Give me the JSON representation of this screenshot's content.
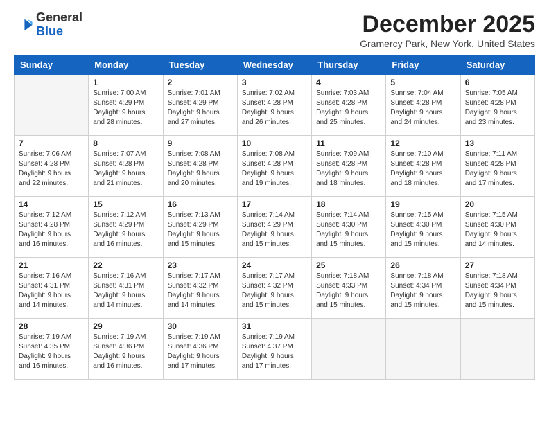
{
  "header": {
    "logo_general": "General",
    "logo_blue": "Blue",
    "month_title": "December 2025",
    "location": "Gramercy Park, New York, United States"
  },
  "days_of_week": [
    "Sunday",
    "Monday",
    "Tuesday",
    "Wednesday",
    "Thursday",
    "Friday",
    "Saturday"
  ],
  "weeks": [
    [
      {
        "date": "",
        "empty": true
      },
      {
        "date": "1",
        "sunrise": "7:00 AM",
        "sunset": "4:29 PM",
        "daylight": "9 hours and 28 minutes."
      },
      {
        "date": "2",
        "sunrise": "7:01 AM",
        "sunset": "4:29 PM",
        "daylight": "9 hours and 27 minutes."
      },
      {
        "date": "3",
        "sunrise": "7:02 AM",
        "sunset": "4:28 PM",
        "daylight": "9 hours and 26 minutes."
      },
      {
        "date": "4",
        "sunrise": "7:03 AM",
        "sunset": "4:28 PM",
        "daylight": "9 hours and 25 minutes."
      },
      {
        "date": "5",
        "sunrise": "7:04 AM",
        "sunset": "4:28 PM",
        "daylight": "9 hours and 24 minutes."
      },
      {
        "date": "6",
        "sunrise": "7:05 AM",
        "sunset": "4:28 PM",
        "daylight": "9 hours and 23 minutes."
      }
    ],
    [
      {
        "date": "7",
        "sunrise": "7:06 AM",
        "sunset": "4:28 PM",
        "daylight": "9 hours and 22 minutes."
      },
      {
        "date": "8",
        "sunrise": "7:07 AM",
        "sunset": "4:28 PM",
        "daylight": "9 hours and 21 minutes."
      },
      {
        "date": "9",
        "sunrise": "7:08 AM",
        "sunset": "4:28 PM",
        "daylight": "9 hours and 20 minutes."
      },
      {
        "date": "10",
        "sunrise": "7:08 AM",
        "sunset": "4:28 PM",
        "daylight": "9 hours and 19 minutes."
      },
      {
        "date": "11",
        "sunrise": "7:09 AM",
        "sunset": "4:28 PM",
        "daylight": "9 hours and 18 minutes."
      },
      {
        "date": "12",
        "sunrise": "7:10 AM",
        "sunset": "4:28 PM",
        "daylight": "9 hours and 18 minutes."
      },
      {
        "date": "13",
        "sunrise": "7:11 AM",
        "sunset": "4:28 PM",
        "daylight": "9 hours and 17 minutes."
      }
    ],
    [
      {
        "date": "14",
        "sunrise": "7:12 AM",
        "sunset": "4:28 PM",
        "daylight": "9 hours and 16 minutes."
      },
      {
        "date": "15",
        "sunrise": "7:12 AM",
        "sunset": "4:29 PM",
        "daylight": "9 hours and 16 minutes."
      },
      {
        "date": "16",
        "sunrise": "7:13 AM",
        "sunset": "4:29 PM",
        "daylight": "9 hours and 15 minutes."
      },
      {
        "date": "17",
        "sunrise": "7:14 AM",
        "sunset": "4:29 PM",
        "daylight": "9 hours and 15 minutes."
      },
      {
        "date": "18",
        "sunrise": "7:14 AM",
        "sunset": "4:30 PM",
        "daylight": "9 hours and 15 minutes."
      },
      {
        "date": "19",
        "sunrise": "7:15 AM",
        "sunset": "4:30 PM",
        "daylight": "9 hours and 15 minutes."
      },
      {
        "date": "20",
        "sunrise": "7:15 AM",
        "sunset": "4:30 PM",
        "daylight": "9 hours and 14 minutes."
      }
    ],
    [
      {
        "date": "21",
        "sunrise": "7:16 AM",
        "sunset": "4:31 PM",
        "daylight": "9 hours and 14 minutes."
      },
      {
        "date": "22",
        "sunrise": "7:16 AM",
        "sunset": "4:31 PM",
        "daylight": "9 hours and 14 minutes."
      },
      {
        "date": "23",
        "sunrise": "7:17 AM",
        "sunset": "4:32 PM",
        "daylight": "9 hours and 14 minutes."
      },
      {
        "date": "24",
        "sunrise": "7:17 AM",
        "sunset": "4:32 PM",
        "daylight": "9 hours and 15 minutes."
      },
      {
        "date": "25",
        "sunrise": "7:18 AM",
        "sunset": "4:33 PM",
        "daylight": "9 hours and 15 minutes."
      },
      {
        "date": "26",
        "sunrise": "7:18 AM",
        "sunset": "4:34 PM",
        "daylight": "9 hours and 15 minutes."
      },
      {
        "date": "27",
        "sunrise": "7:18 AM",
        "sunset": "4:34 PM",
        "daylight": "9 hours and 15 minutes."
      }
    ],
    [
      {
        "date": "28",
        "sunrise": "7:19 AM",
        "sunset": "4:35 PM",
        "daylight": "9 hours and 16 minutes."
      },
      {
        "date": "29",
        "sunrise": "7:19 AM",
        "sunset": "4:36 PM",
        "daylight": "9 hours and 16 minutes."
      },
      {
        "date": "30",
        "sunrise": "7:19 AM",
        "sunset": "4:36 PM",
        "daylight": "9 hours and 17 minutes."
      },
      {
        "date": "31",
        "sunrise": "7:19 AM",
        "sunset": "4:37 PM",
        "daylight": "9 hours and 17 minutes."
      },
      {
        "date": "",
        "empty": true
      },
      {
        "date": "",
        "empty": true
      },
      {
        "date": "",
        "empty": true
      }
    ]
  ],
  "labels": {
    "sunrise_label": "Sunrise:",
    "sunset_label": "Sunset:",
    "daylight_label": "Daylight:"
  }
}
